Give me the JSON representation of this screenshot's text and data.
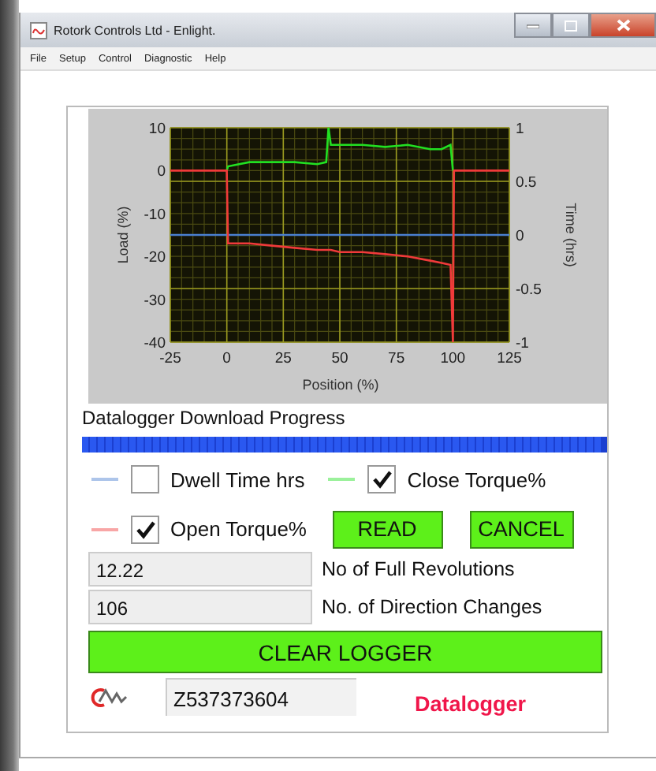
{
  "window": {
    "title": "Rotork Controls Ltd - Enlight."
  },
  "menu": [
    {
      "label": "File"
    },
    {
      "label": "Setup"
    },
    {
      "label": "Control"
    },
    {
      "label": "Diagnostic"
    },
    {
      "label": "Help"
    }
  ],
  "chart": {
    "chart_data": {
      "type": "line",
      "xlabel": "Position (%)",
      "ylabel": "Load (%)",
      "y2label": "Time (hrs)",
      "x": [
        -25,
        0,
        0.5,
        10,
        20,
        30,
        40,
        44,
        45,
        46,
        50,
        60,
        70,
        80,
        90,
        95,
        99,
        100,
        100.5,
        125
      ],
      "series": [
        {
          "color": "#4a7fd0",
          "axis": "y2",
          "values": [
            0,
            0,
            0,
            0,
            0,
            0,
            0,
            0,
            0,
            0,
            0,
            0,
            0,
            0,
            0,
            0,
            0,
            0,
            0,
            0
          ]
        },
        {
          "color": "#22e022",
          "values": [
            null,
            0,
            1,
            2,
            2,
            2,
            1.5,
            2,
            10,
            6,
            6,
            6,
            5.5,
            6,
            5,
            5,
            6,
            0,
            null,
            null
          ]
        },
        {
          "color": "#f03a3a",
          "values": [
            0,
            0,
            -17,
            -17,
            -17.5,
            -18,
            -18.5,
            -18.5,
            -18.5,
            -18.5,
            -19,
            -19,
            -19.5,
            -20,
            -21,
            -21.5,
            -22,
            -40,
            0,
            0
          ]
        }
      ],
      "grid": true,
      "xlim": [
        -25,
        125
      ],
      "ylim": [
        -40,
        10
      ],
      "y2lim": [
        -1,
        1
      ],
      "xticks": [
        -25,
        0,
        25,
        50,
        75,
        100,
        125
      ],
      "yticks": [
        -40,
        -30,
        -20,
        -10,
        0,
        10
      ],
      "y2ticks": [
        -1,
        -0.5,
        0,
        0.5,
        1
      ]
    }
  },
  "progress": {
    "label": "Datalogger Download Progress",
    "level": 1
  },
  "legend": [
    {
      "label": "Dwell Time hrs",
      "checked": false
    },
    {
      "label": "Close Torque%",
      "checked": true
    },
    {
      "label": "Open Torque%",
      "checked": true
    }
  ],
  "buttons": [
    {
      "label": "READ"
    },
    {
      "label": "CANCEL"
    }
  ],
  "readouts": [
    {
      "value": "12.22",
      "label": "No of Full Revolutions"
    },
    {
      "value": "106",
      "label": "No. of Direction Changes"
    }
  ],
  "clear_button": {
    "label": "CLEAR LOGGER"
  },
  "serial": {
    "value": "Z537373604"
  },
  "mode": {
    "label": "Datalogger"
  }
}
